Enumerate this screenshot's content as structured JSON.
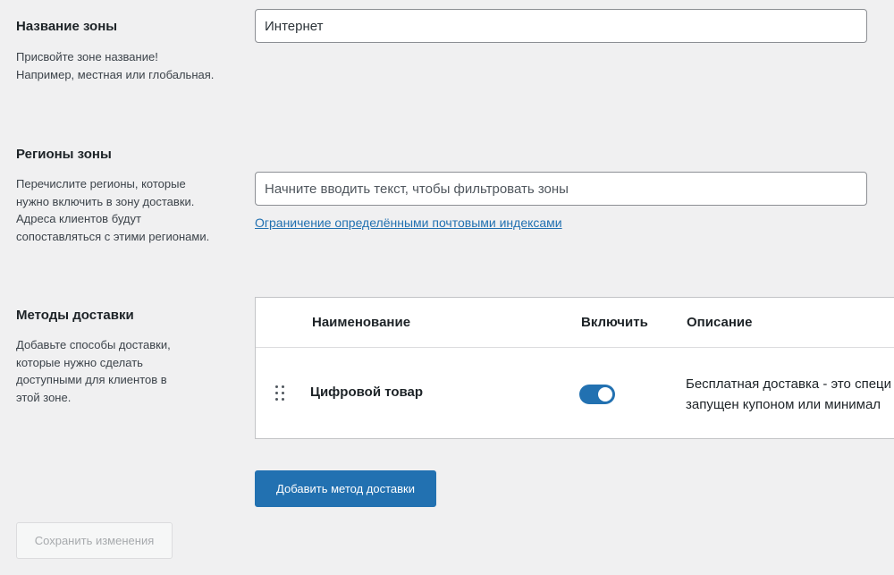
{
  "zone_name": {
    "title": "Название зоны",
    "description": "Присвойте зоне название!\nНапример, местная или глобальная.",
    "value": "Интернет"
  },
  "zone_regions": {
    "title": "Регионы зоны",
    "description": "Перечислите регионы, которые\nнужно включить в зону доставки.\nАдреса клиентов будут\nсопоставляться с этими регионами.",
    "placeholder": "Начните вводить текст, чтобы фильтровать зоны",
    "postcode_link": "Ограничение определёнными почтовыми индексами"
  },
  "shipping_methods": {
    "title": "Методы доставки",
    "description": "Добавьте способы доставки,\nкоторые нужно сделать\nдоступными для клиентов в\nэтой зоне.",
    "columns": {
      "name": "Наименование",
      "enabled": "Включить",
      "description": "Описание"
    },
    "rows": [
      {
        "name": "Цифровой товар",
        "enabled": true,
        "description_line1": "Бесплатная доставка - это специ",
        "description_line2": "запущен купоном или минимал"
      }
    ],
    "add_button": "Добавить метод доставки"
  },
  "save_button": "Сохранить изменения",
  "colors": {
    "accent": "#2271b1",
    "background": "#f0f0f1",
    "disabled_text": "#a7aaad"
  },
  "icons": {
    "drag_handle": "drag-handle-icon"
  }
}
